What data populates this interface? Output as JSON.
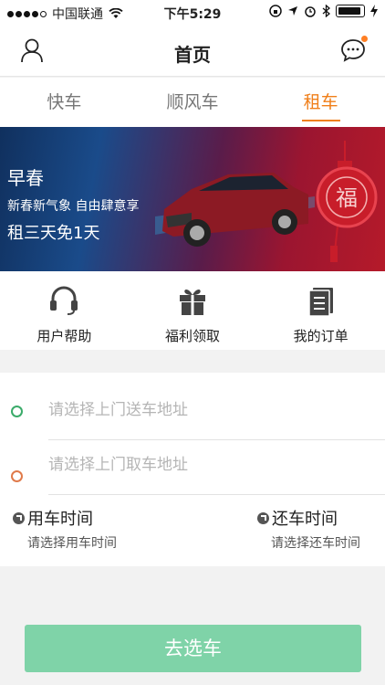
{
  "status_bar": {
    "carrier": "中国联通",
    "time": "下午5:29"
  },
  "nav": {
    "title": "首页",
    "left_icon": "user-icon",
    "right_icon": "message-icon"
  },
  "tabs": [
    {
      "label": "快车",
      "active": false
    },
    {
      "label": "顺风车",
      "active": false
    },
    {
      "label": "租车",
      "active": true
    }
  ],
  "banner": {
    "title": "早春",
    "subtitle": "新春新气象 自由肆意享",
    "promo": "租三天免1天",
    "charm_text": "福"
  },
  "actions": [
    {
      "label": "用户帮助",
      "icon": "headset-icon"
    },
    {
      "label": "福利领取",
      "icon": "gift-icon"
    },
    {
      "label": "我的订单",
      "icon": "orders-icon"
    }
  ],
  "form": {
    "delivery_placeholder": "请选择上门送车地址",
    "pickup_placeholder": "请选择上门取车地址",
    "use_time_title": "用车时间",
    "use_time_hint": "请选择用车时间",
    "return_time_title": "还车时间",
    "return_time_hint": "请选择还车时间"
  },
  "submit_label": "去选车",
  "colors": {
    "accent": "#f07f1a",
    "button": "#7fd3a8",
    "delivery_dot": "#3bab6a",
    "pickup_dot": "#e07a4a"
  }
}
